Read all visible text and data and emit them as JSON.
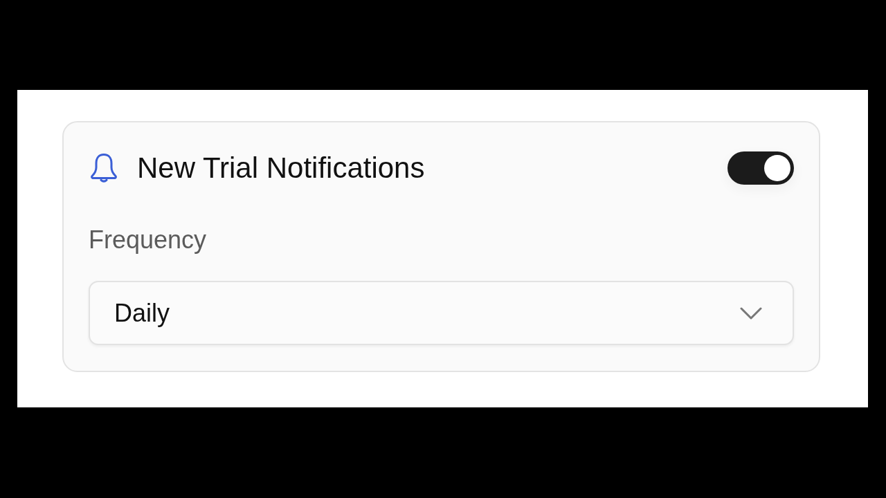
{
  "notification_card": {
    "title": "New Trial Notifications",
    "enabled": true,
    "frequency": {
      "label": "Frequency",
      "value": "Daily"
    }
  }
}
